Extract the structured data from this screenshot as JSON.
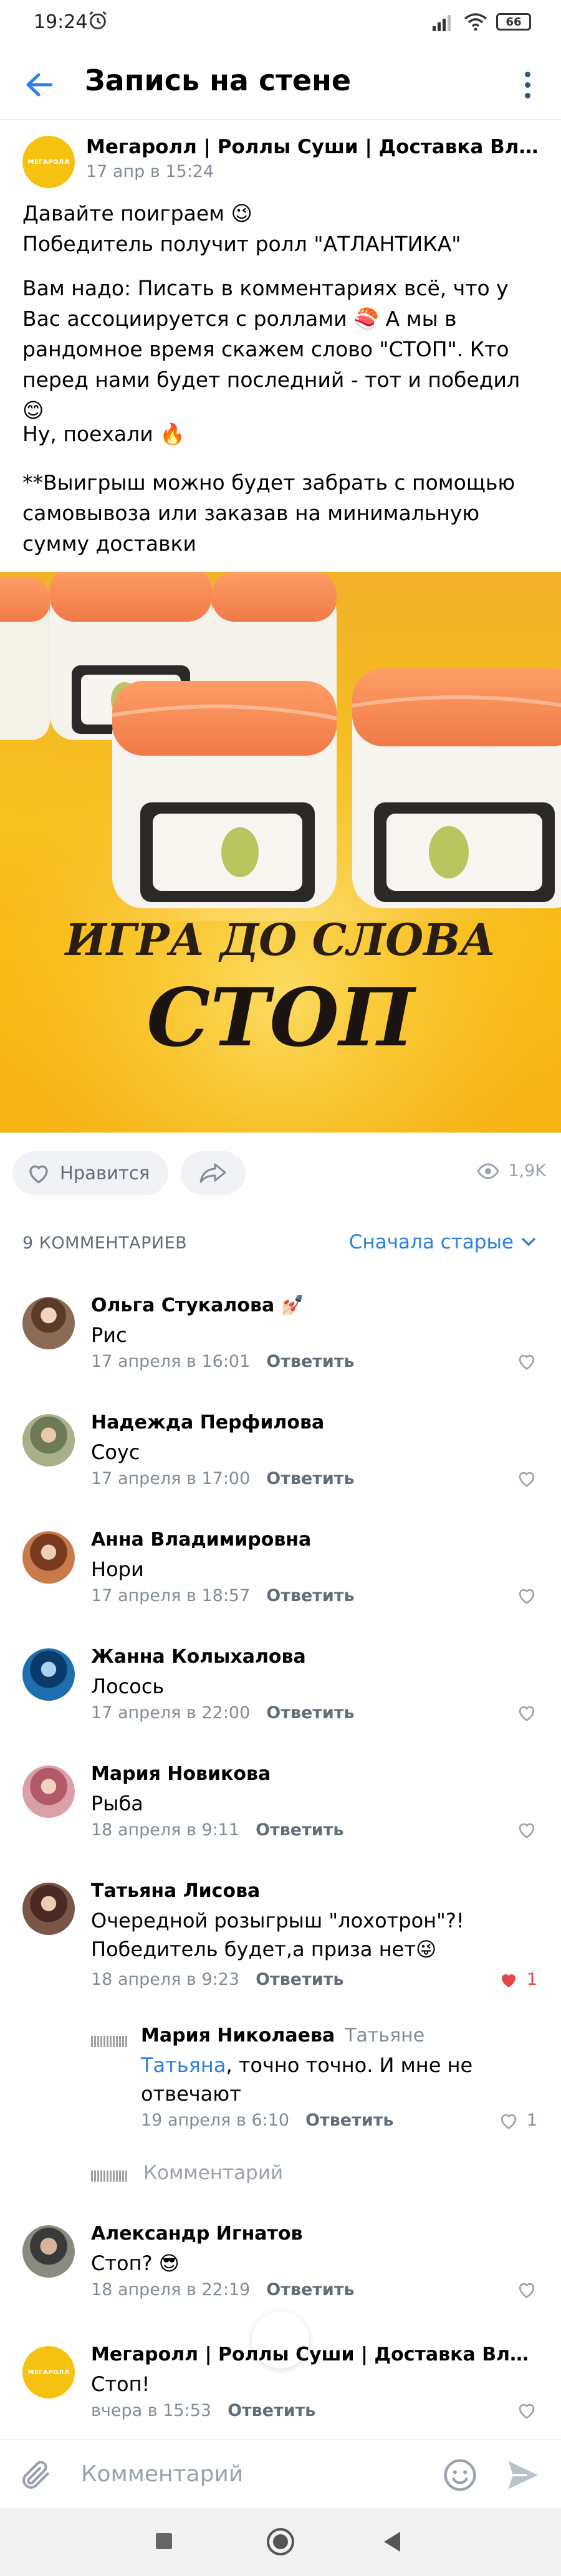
{
  "status_bar": {
    "time": "19:24",
    "battery": "66"
  },
  "header": {
    "title": "Запись на стене"
  },
  "post": {
    "author": "Мегаролл | Роллы Суши | Доставка Владивосток",
    "logo_text": "МЕГАРОЛЛ",
    "date": "17 апр в 15:24",
    "paragraphs": [
      "Давайте поиграем 😉\nПобедитель получит ролл \"АТЛАНТИКА\"",
      "Вам надо: Писать в комментариях всё, что у Вас ассоциируется с роллами 🍣 А мы в рандомное время скажем слово \"СТОП\". Кто перед нами будет последний - тот и победил 😊",
      "Ну, поехали 🔥",
      "**Выигрыш можно будет забрать с помощью самовывоза или заказав на минимальную сумму доставки"
    ],
    "image": {
      "line1": "ИГРА ДО СЛОВА",
      "line2": "СТОП"
    },
    "like_label": "Нравится",
    "views": "1,9K"
  },
  "comments_header": {
    "count_label": "9 КОММЕНТАРИЕВ",
    "sort_label": "Сначала старые"
  },
  "reply_label": "Ответить",
  "comments": [
    {
      "author": "Ольга Стукалова 💅🏻",
      "text": "Рис",
      "date": "17 апреля в 16:01"
    },
    {
      "author": "Надежда Перфилова",
      "text": "Соус",
      "date": "17 апреля в 17:00"
    },
    {
      "author": "Анна Владимировна",
      "text": "Нори",
      "date": "17 апреля в 18:57"
    },
    {
      "author": "Жанна Колыхалова",
      "text": "Лосось",
      "date": "17 апреля в 22:00"
    },
    {
      "author": "Мария Новикова",
      "text": "Рыба",
      "date": "18 апреля в 9:11"
    },
    {
      "author": "Татьяна Лисова",
      "text": "Очередной розыгрыш \"лохотрон\"?! Победитель будет,а приза нет😜",
      "date": "18 апреля в 9:23",
      "likes": "1"
    },
    {
      "author": "Александр Игнатов",
      "text": "Стоп? 😎",
      "date": "18 апреля в 22:19"
    },
    {
      "author": "Мегаролл | Роллы Суши | Доставка Владимир",
      "text": "Стоп!",
      "date": "вчера в 15:53"
    }
  ],
  "reply": {
    "author": "Мария Николаева",
    "to": "Татьяне",
    "mention": "Татьяна",
    "text": ", точно точно. И мне не отвечают",
    "date": "19 апреля в 6:10",
    "likes": "1",
    "comment_placeholder": "Комментарий"
  },
  "input": {
    "placeholder": "Комментарий"
  },
  "colors": {
    "accent": "#2d81e0",
    "secondary_text": "#818c99",
    "like_red": "#e64646",
    "logo_yellow": "#f5c211"
  }
}
